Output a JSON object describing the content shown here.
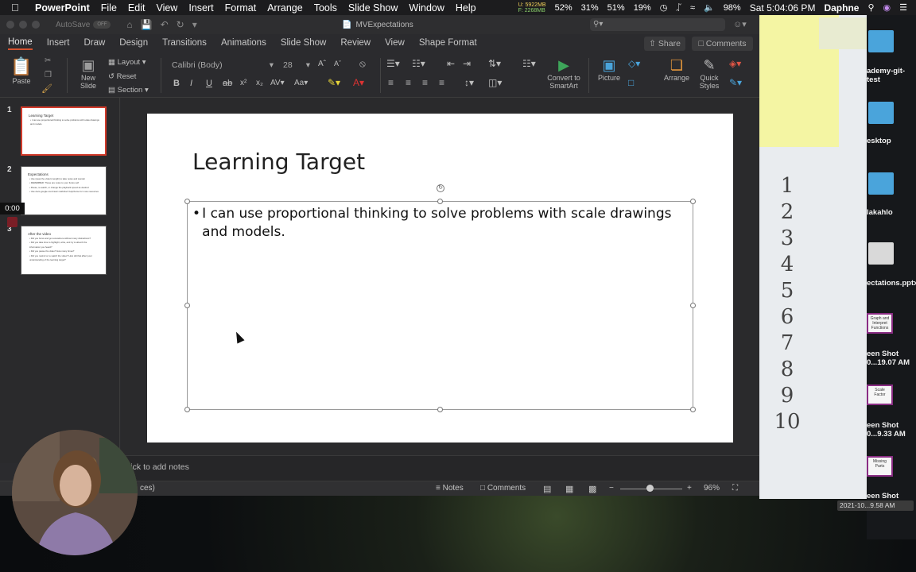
{
  "menubar": {
    "app_name": "PowerPoint",
    "items": [
      "File",
      "Edit",
      "View",
      "Insert",
      "Format",
      "Arrange",
      "Tools",
      "Slide Show",
      "Window",
      "Help"
    ],
    "mem_u": "U: 5922MB",
    "mem_f": "F: 2268MB",
    "cpu1": "52%",
    "cpu2": "31%",
    "cpu3": "51%",
    "cpu4": "19%",
    "battery": "98%",
    "clock": "Sat 5:04:06 PM",
    "user": "Daphne"
  },
  "titlebar": {
    "autosave_label": "AutoSave",
    "autosave_state": "OFF",
    "document_title": "MVExpectations"
  },
  "ribbon_tabs": [
    "Home",
    "Insert",
    "Draw",
    "Design",
    "Transitions",
    "Animations",
    "Slide Show",
    "Review",
    "View",
    "Shape Format"
  ],
  "share_label": "Share",
  "comments_label": "Comments",
  "ribbon": {
    "paste": "Paste",
    "new_slide_1": "New",
    "new_slide_2": "Slide",
    "layout": "Layout",
    "reset": "Reset",
    "section": "Section",
    "font_name": "Calibri (Body)",
    "font_size": "28",
    "convert_1": "Convert to",
    "convert_2": "SmartArt",
    "picture": "Picture",
    "arrange": "Arrange",
    "quick_1": "Quick",
    "quick_2": "Styles"
  },
  "slides": [
    {
      "num": "1",
      "title": "Learning Target",
      "lines": [
        "• I can use proportional thinking to solve problems with scale drawings",
        "  and models."
      ]
    },
    {
      "num": "2",
      "title": "Expectations",
      "lines": [
        "• Use (wear the video's length) to take notes and wonder",
        "• REMEMBER: These are notes to your future self",
        "• Pause, re-watch, or change the playback speed as desired",
        "• Use docs.google.com/view/ math/doc/ help/home for more resources"
      ]
    },
    {
      "num": "3",
      "title": "After the video",
      "lines": [
        "• Did you focus and go somewhere without many distractions?",
        "• Did you take time to highlight, write, and try to absorb the",
        "  information you heard?",
        "• Did you pause the video? How many times?",
        "• Did you rewind or re-watch the video? How did that affect your",
        "  understanding of the learning target?"
      ]
    }
  ],
  "timer": "0:00",
  "slide": {
    "title": "Learning Target",
    "bullet": "I can use proportional thinking to solve problems with scale drawings and models."
  },
  "notes_placeholder": "lick to add notes",
  "statusbar": {
    "left_text": "ces)",
    "notes": "Notes",
    "comments": "Comments",
    "zoom": "96%"
  },
  "paper_numbers": [
    "1",
    "2",
    "3",
    "4",
    "5",
    "6",
    "7",
    "8",
    "9",
    "10"
  ],
  "desktop": {
    "label1": "ademy-git-test",
    "label2": "esktop",
    "label3": "lakahlo",
    "label4": "ectations.pptx",
    "thumb1": "Graph and Interpret Functions",
    "label5": "een Shot 0...19.07 AM",
    "thumb2": "Scale Factor",
    "label6": "een Shot 0...9.33 AM",
    "thumb3": "Missing Parts",
    "label7": "een Shot",
    "timestamp": "2021-10...9.58 AM"
  }
}
